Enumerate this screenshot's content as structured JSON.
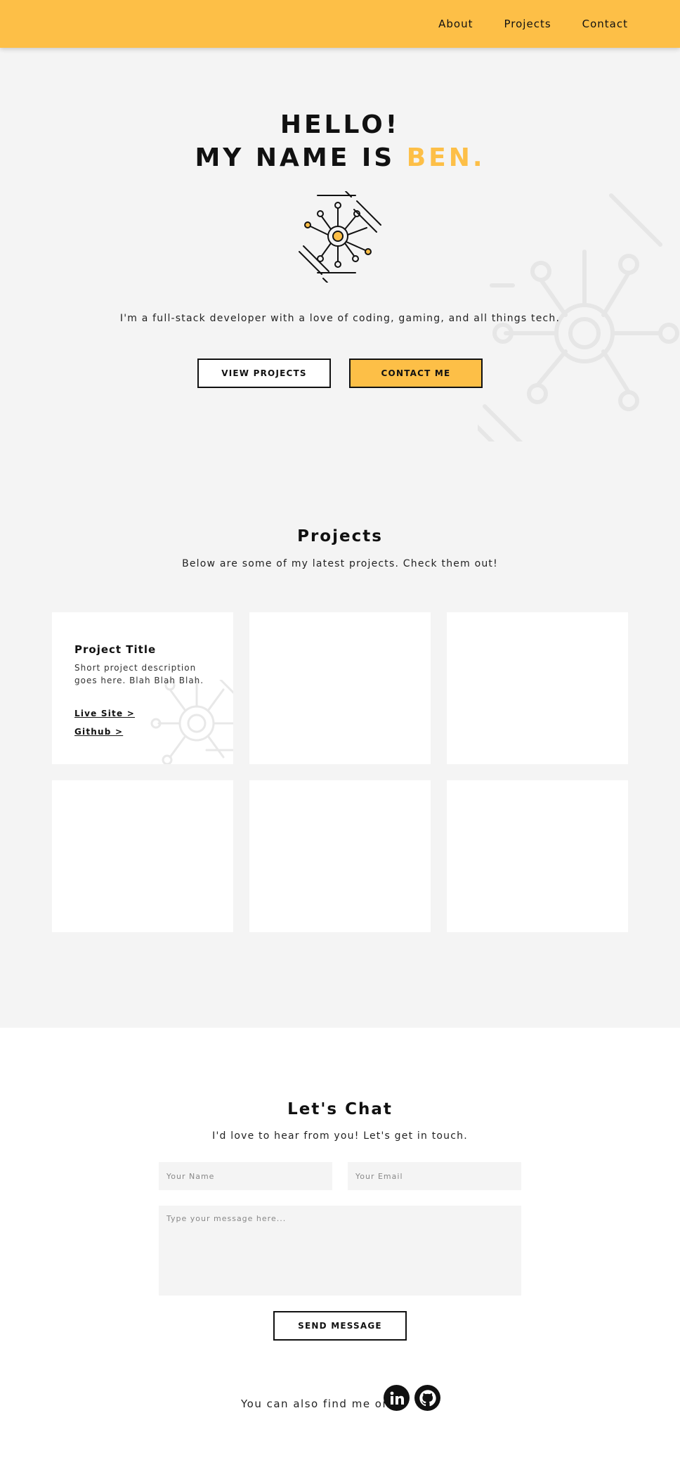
{
  "nav": {
    "items": [
      "About",
      "Projects",
      "Contact"
    ]
  },
  "hero": {
    "line1": "HELLO!",
    "line2_prefix": "MY NAME IS ",
    "line2_accent": "BEN.",
    "description": "I'm a full-stack developer with a love of coding, gaming, and all things tech.",
    "view_projects_label": "VIEW PROJECTS",
    "contact_me_label": "CONTACT ME"
  },
  "projects": {
    "title": "Projects",
    "subtitle": "Below are some of my latest projects. Check them out!",
    "cards": [
      {
        "title": "Project Title",
        "description": "Short project description goes here. Blah Blah Blah.",
        "live_label": "Live Site >",
        "github_label": "Github >"
      }
    ]
  },
  "contact": {
    "title": "Let's Chat",
    "subtitle": "I'd love to hear from you! Let's get in touch.",
    "name_placeholder": "Your Name",
    "email_placeholder": "Your Email",
    "message_placeholder": "Type your message here...",
    "send_label": "SEND MESSAGE",
    "social_text": "You can also find me on",
    "social_icons": [
      "linkedin-icon",
      "github-icon"
    ]
  },
  "colors": {
    "accent": "#fdbf47",
    "background": "#f4f4f4",
    "text": "#111111"
  }
}
